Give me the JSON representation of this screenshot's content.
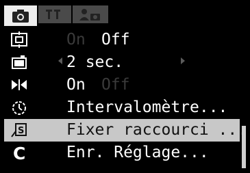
{
  "tabs": [
    {
      "name": "shooting",
      "icon": "camera-icon"
    },
    {
      "name": "setup",
      "icon": "wrench-icon"
    },
    {
      "name": "my-camera",
      "icon": "person-camera-icon"
    }
  ],
  "menu": {
    "items": [
      {
        "id": "af-frame",
        "icon": "af-frame-icon",
        "value_dim": "On",
        "value": "Off",
        "selected": false
      },
      {
        "id": "review",
        "icon": "review-icon",
        "value": "2 sec.",
        "has_arrows": true,
        "selected": false
      },
      {
        "id": "flip",
        "icon": "flip-icon",
        "value": "On",
        "value_dim": "Off",
        "selected": false
      },
      {
        "id": "intervalometer",
        "icon": "timer-icon",
        "value": "Intervalomètre...",
        "selected": false
      },
      {
        "id": "shortcut",
        "icon": "shortcut-icon",
        "value": "Fixer raccourci ...",
        "selected": true
      },
      {
        "id": "save-settings",
        "icon": "c-icon",
        "value": "Enr. Réglage...",
        "selected": false
      }
    ]
  },
  "colors": {
    "background": "#000000",
    "selected_row": "#c8c8c8",
    "active_tab": "#ededed",
    "inactive_tab": "#4a4a4a",
    "dim_text": "#3a3a3a"
  }
}
